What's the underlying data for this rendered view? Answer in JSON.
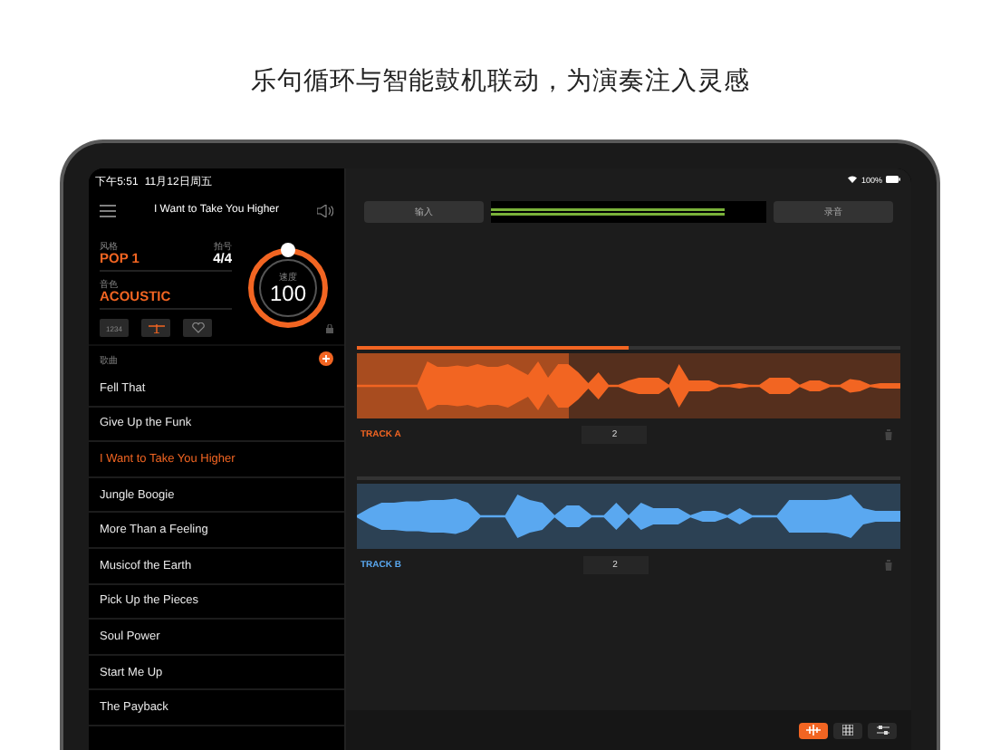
{
  "headline": "乐句循环与智能鼓机联动，为演奏注入灵感",
  "status_bar": {
    "time": "下午5:51",
    "date": "11月12日周五",
    "battery": "100%"
  },
  "sidebar": {
    "title": "I Want to Take You Higher",
    "style": {
      "label": "风格",
      "value": "POP 1"
    },
    "meter": {
      "label": "拍号",
      "value": "4/4"
    },
    "kit": {
      "label": "音色",
      "value": "ACOUSTIC"
    },
    "count_in": "1234",
    "tempo": {
      "label": "速度",
      "value": "100"
    },
    "songs_label": "歌曲",
    "songs": [
      {
        "title": "Fell That",
        "selected": false
      },
      {
        "title": "Give Up the Funk",
        "selected": false
      },
      {
        "title": "I Want to Take You Higher",
        "selected": true
      },
      {
        "title": "Jungle Boogie",
        "selected": false
      },
      {
        "title": "More Than a Feeling",
        "selected": false
      },
      {
        "title": "Musicof the Earth",
        "selected": false
      },
      {
        "title": "Pick Up the Pieces",
        "selected": false
      },
      {
        "title": "Soul Power",
        "selected": false
      },
      {
        "title": "Start Me Up",
        "selected": false
      },
      {
        "title": "The Payback",
        "selected": false
      }
    ]
  },
  "main": {
    "input_button": "输入",
    "input_meter": {
      "level": 0.85
    },
    "record_button": "录音",
    "tracks": [
      {
        "name": "TRACK A",
        "color": "#f26522",
        "count": "2",
        "level": 0.5
      },
      {
        "name": "TRACK B",
        "color": "#5aa8f0",
        "count": "2",
        "level": 0
      }
    ],
    "view_modes": [
      {
        "kind": "waveform",
        "selected": true
      },
      {
        "kind": "grid",
        "selected": false
      },
      {
        "kind": "mixer",
        "selected": false
      }
    ]
  }
}
